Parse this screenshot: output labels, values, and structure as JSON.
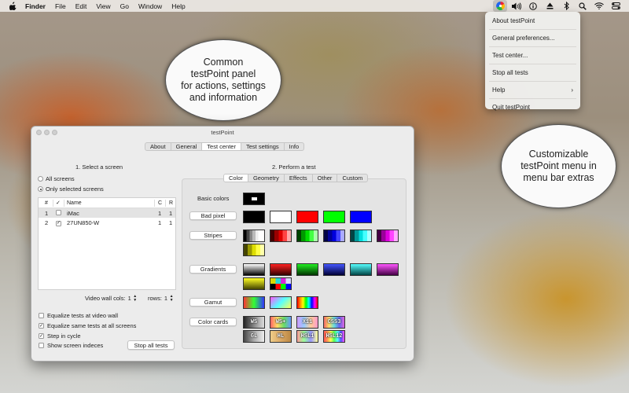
{
  "menubar": {
    "app_name": "Finder",
    "items": [
      "File",
      "Edit",
      "View",
      "Go",
      "Window",
      "Help"
    ],
    "extras_icons": [
      "testpoint-icon",
      "volume-icon",
      "info-icon",
      "eject-icon",
      "bluetooth-icon",
      "search-icon",
      "wifi-icon",
      "control-center-icon"
    ]
  },
  "dropdown": {
    "items": [
      "About testPoint",
      "General preferences...",
      "Test center...",
      "Stop all tests",
      "Help",
      "Quit testPoint"
    ],
    "help_chevron": "›"
  },
  "callouts": {
    "panel": "Common\ntestPoint panel\nfor actions, settings\nand information",
    "menu": "Customizable\ntestPoint menu in\nmenu bar extras"
  },
  "window": {
    "title": "testPoint",
    "tabs": [
      "About",
      "General",
      "Test center",
      "Test settings",
      "Info"
    ],
    "selected_tab": "Test center",
    "select_screen": {
      "heading": "1. Select a screen",
      "radio_all": "All screens",
      "radio_selected": "Only selected screens",
      "columns": {
        "num": "#",
        "check": "✓",
        "name": "Name",
        "c": "C",
        "r": "R"
      },
      "rows": [
        {
          "num": "1",
          "checked": false,
          "name": "iMac",
          "c": "1",
          "r": "1"
        },
        {
          "num": "2",
          "checked": true,
          "name": "27UN850-W",
          "c": "1",
          "r": "1"
        }
      ],
      "video_wall_cols_label": "Video wall cols:",
      "video_wall_cols_value": "1",
      "rows_label": "rows:",
      "rows_value": "1",
      "options": [
        {
          "label": "Equalize tests at video wall",
          "checked": false
        },
        {
          "label": "Equalize same tests at all screens",
          "checked": true
        },
        {
          "label": "Step in cycle",
          "checked": true
        },
        {
          "label": "Show screen indeces",
          "checked": false
        }
      ],
      "stop_all_button": "Stop all tests"
    },
    "perform_test": {
      "heading": "2. Perform a test",
      "subtabs": [
        "Color",
        "Geometry",
        "Effects",
        "Other",
        "Custom"
      ],
      "selected_subtab": "Color",
      "basic_colors_label": "Basic colors",
      "buttons": {
        "bad_pixel": "Bad pixel",
        "stripes": "Stripes",
        "gradients": "Gradients",
        "gamut": "Gamut",
        "color_cards": "Color cards"
      },
      "color_cards": [
        "WS",
        "WS+",
        "X11",
        "CSS3",
        "GL",
        "HL",
        "HSL1",
        "HSL12"
      ]
    }
  },
  "colors": {
    "bad_pixel": [
      "#000000",
      "#ffffff",
      "#ff0000",
      "#00ff00",
      "#0000ff"
    ]
  }
}
